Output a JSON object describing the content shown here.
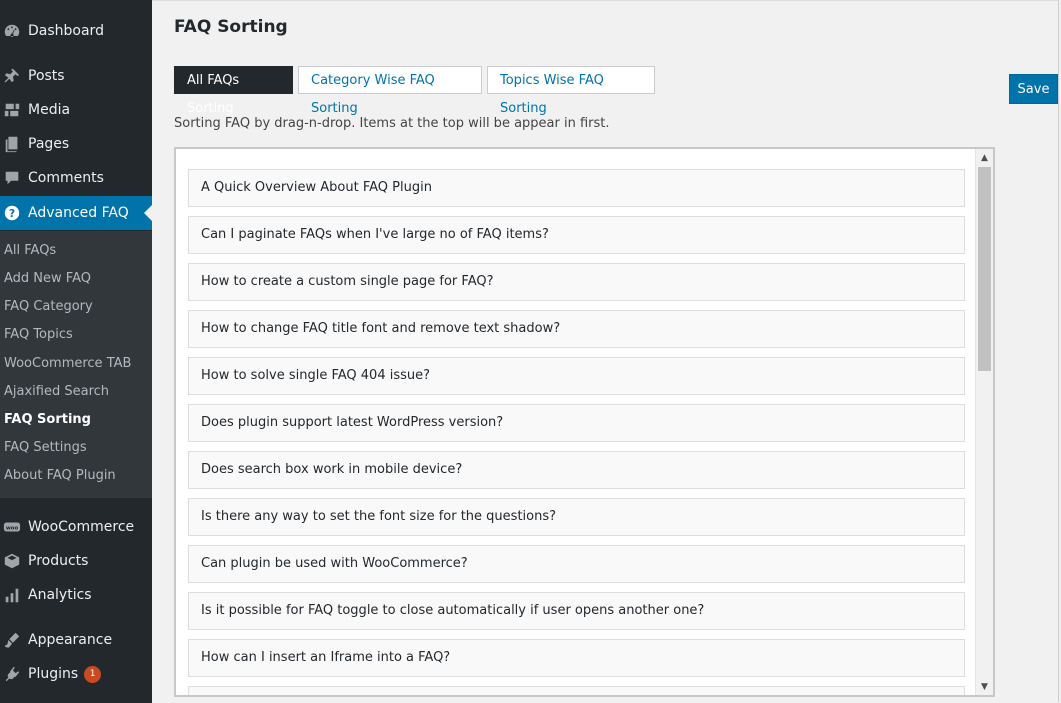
{
  "sidebar": {
    "top_items": [
      {
        "label": "Dashboard",
        "icon": "dashboard-icon"
      },
      {
        "label": "Posts",
        "icon": "pushpin-icon"
      },
      {
        "label": "Media",
        "icon": "media-icon"
      },
      {
        "label": "Pages",
        "icon": "pages-icon"
      },
      {
        "label": "Comments",
        "icon": "comment-icon"
      },
      {
        "label": "Advanced FAQ",
        "icon": "question-icon"
      }
    ],
    "submenu": [
      "All FAQs",
      "Add New FAQ",
      "FAQ Category",
      "FAQ Topics",
      "WooCommerce TAB",
      "Ajaxified Search",
      "FAQ Sorting",
      "FAQ Settings",
      "About FAQ Plugin"
    ],
    "bottom_items": [
      {
        "label": "WooCommerce",
        "icon": "woocommerce-icon"
      },
      {
        "label": "Products",
        "icon": "products-icon"
      },
      {
        "label": "Analytics",
        "icon": "analytics-icon"
      },
      {
        "label": "Appearance",
        "icon": "appearance-icon"
      },
      {
        "label": "Plugins",
        "icon": "plugin-icon",
        "badge": "1"
      }
    ]
  },
  "page": {
    "title": "FAQ Sorting",
    "tabs": [
      "All FAQs Sorting",
      "Category Wise FAQ Sorting",
      "Topics Wise FAQ Sorting"
    ],
    "save_label": "Save",
    "description": "Sorting FAQ by drag-n-drop. Items at the top will be appear in first."
  },
  "faqs": [
    "A Quick Overview About FAQ Plugin",
    "Can I paginate FAQs when I've large no of FAQ items?",
    "How to create a custom single page for FAQ?",
    "How to change FAQ title font and remove text shadow?",
    "How to solve single FAQ 404 issue?",
    "Does plugin support latest WordPress version?",
    "Does search box work in mobile device?",
    "Is there any way to set the font size for the questions?",
    "Can plugin be used with WooCommerce?",
    "Is it possible for FAQ toggle to close automatically if user opens another one?",
    "How can I insert an Iframe into a FAQ?"
  ],
  "colors": {
    "sidebar_bg": "#23282d",
    "submenu_bg": "#32373c",
    "accent": "#0073aa",
    "badge": "#ca4a1f"
  }
}
